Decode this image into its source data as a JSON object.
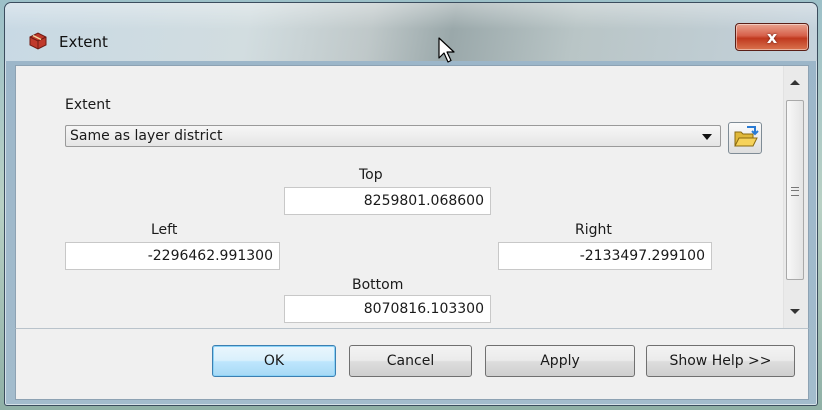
{
  "window": {
    "title": "Extent",
    "close_label": "x"
  },
  "extent": {
    "section_label": "Extent",
    "selected_option": "Same as layer district"
  },
  "coordinates": {
    "top_label": "Top",
    "top_value": "8259801.068600",
    "left_label": "Left",
    "left_value": "-2296462.991300",
    "right_label": "Right",
    "right_value": "-2133497.299100",
    "bottom_label": "Bottom",
    "bottom_value": "8070816.103300"
  },
  "buttons": {
    "ok": "OK",
    "cancel": "Cancel",
    "apply": "Apply",
    "show_help": "Show Help >>"
  },
  "icons": {
    "app": "toolbox-icon",
    "browse": "open-folder-icon",
    "close": "close-icon"
  }
}
